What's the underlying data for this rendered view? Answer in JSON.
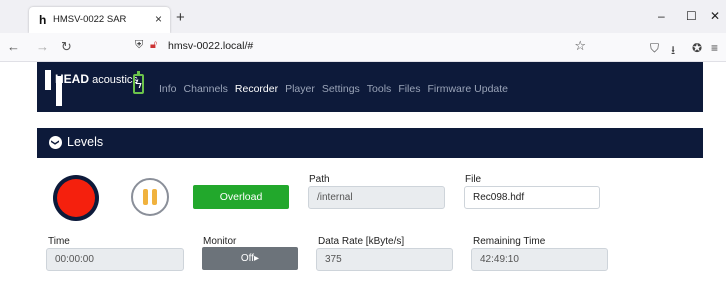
{
  "browser": {
    "tab_favicon": "h",
    "tab_title": "HMSV-0022 SAR",
    "tab_close": "×",
    "new_tab": "+",
    "minimize": "–",
    "maximize": "☐",
    "close": "✕",
    "back": "←",
    "forward": "→",
    "reload": "↻",
    "url": "hmsv-0022.local/#",
    "bookmark": "☆",
    "pocket": "⛉",
    "download": "⭳",
    "extension": "✪",
    "menu": "≡"
  },
  "app": {
    "logo_text_bold": "HEAD",
    "logo_text": " acoustics",
    "battery_icon": "ϟ",
    "menu": [
      {
        "label": "Info",
        "active": false
      },
      {
        "label": "Channels",
        "active": false
      },
      {
        "label": "Recorder",
        "active": true
      },
      {
        "label": "Player",
        "active": false
      },
      {
        "label": "Settings",
        "active": false
      },
      {
        "label": "Tools",
        "active": false
      },
      {
        "label": "Files",
        "active": false
      },
      {
        "label": "Firmware Update",
        "active": false
      }
    ]
  },
  "levels": {
    "icon": "❯",
    "label": "Levels"
  },
  "recorder": {
    "overload_label": "Overload",
    "path_label": "Path",
    "path_value": "/internal",
    "file_label": "File",
    "file_value": "Rec098.hdf",
    "time_label": "Time",
    "time_value": "00:00:00",
    "monitor_label": "Monitor",
    "monitor_value": "Off▸",
    "data_rate_label": "Data Rate [kByte/s]",
    "data_rate_value": "375",
    "remaining_label": "Remaining Time",
    "remaining_value": "42:49:10"
  },
  "colors": {
    "header_bg": "#0d1a3a",
    "record": "#f5200d",
    "pause": "#f0b23e",
    "overload": "#22a82c",
    "monitor": "#6c737a"
  }
}
